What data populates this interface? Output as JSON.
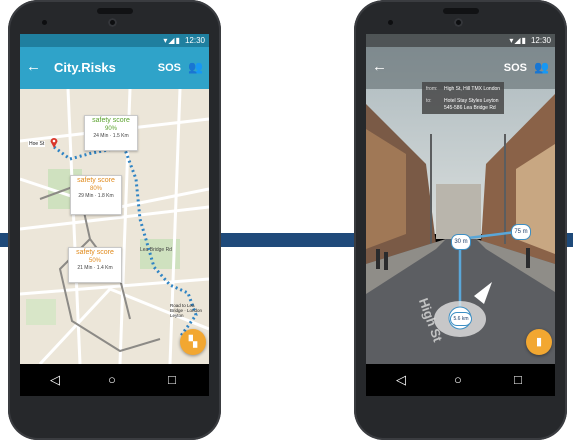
{
  "colors": {
    "background": "#ffffff",
    "band": "#1f4a7a",
    "app_bar": "#2fa3c9",
    "route": "#2f84c4",
    "fab": "#f2a731",
    "score_text": "#5aa22d"
  },
  "left_phone": {
    "status_bar": {
      "signal_icon": "signal-wifi-battery-icon",
      "time": "12:30"
    },
    "app_bar": {
      "back_icon": "arrow-left-icon",
      "title": "City.Risks",
      "sos_label": "SOS",
      "people_icon": "people-icon"
    },
    "map": {
      "streets": [
        "Hoe St",
        "Lea Bridge Rd"
      ],
      "start_marker_icon": "map-pin-icon",
      "destination_label": "Road to Lea Bridge · London Leyton",
      "score_cards": [
        {
          "title": "safety score",
          "value": "90%",
          "detail": "24 Min · 1.5 Km"
        },
        {
          "title": "safety score",
          "value": "80%",
          "detail": "29 Min · 1.8 Km"
        },
        {
          "title": "safety score",
          "value": "50%",
          "detail": "21 Min · 1.4 Km"
        }
      ]
    },
    "fab_icon": "map-fold-icon",
    "nav_bar": {
      "back_icon": "triangle-back-icon",
      "home_icon": "circle-home-icon",
      "recent_icon": "square-recent-icon"
    }
  },
  "right_phone": {
    "status_bar": {
      "signal_icon": "signal-wifi-battery-icon",
      "time": "12:30"
    },
    "app_bar": {
      "back_icon": "arrow-left-icon",
      "sos_label": "SOS",
      "people_icon": "people-icon"
    },
    "info_box": {
      "from_label": "from:",
      "from_value": "High St, Hill TMX London",
      "to_label": "to:",
      "to_value": "Hotel Stay Styles Leyton",
      "to_value_2": "545-586 Lea Bridge Rd"
    },
    "ar_markers": [
      "30 m",
      "75 m",
      "5.6 km"
    ],
    "street_text": "High St",
    "fab_icon": "map-icon",
    "nav_bar": {
      "back_icon": "triangle-back-icon",
      "home_icon": "circle-home-icon",
      "recent_icon": "square-recent-icon"
    }
  }
}
